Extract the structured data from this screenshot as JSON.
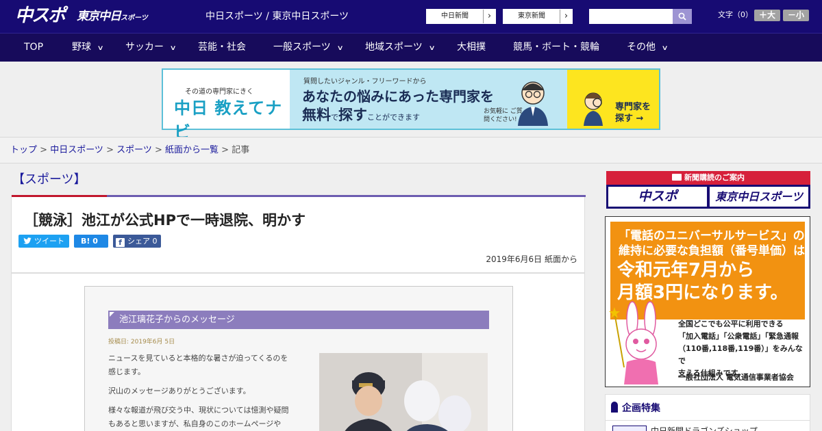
{
  "header": {
    "logo_main": "中スポ",
    "logo_sub": "東京中日",
    "logo_sub_small": "スポーツ",
    "title": "中日スポーツ / 東京中日スポーツ",
    "link_chunichi": "中日新聞",
    "link_tokyo": "東京新聞",
    "arrow": "›",
    "search_placeholder": "",
    "font_size_label": "文字（0）",
    "font_bigger": "＋大",
    "font_smaller": "－小"
  },
  "nav": {
    "items": [
      {
        "label": "TOP"
      },
      {
        "label": "野球"
      },
      {
        "label": "サッカー"
      },
      {
        "label": "芸能・社会"
      },
      {
        "label": "一般スポーツ"
      },
      {
        "label": "地域スポーツ"
      },
      {
        "label": "大相撲"
      },
      {
        "label": "競馬・ボート・競輪"
      },
      {
        "label": "その他"
      }
    ],
    "chevron": "∨"
  },
  "banner": {
    "small": "その道の専門家にきく",
    "brand": "中日 教えてナビ",
    "line1": "質問したいジャンル・フリーワードから",
    "line2": "あなたの悩みにあった専門家を",
    "line3a": "無料",
    "line3b": "で",
    "line3c": "探す",
    "line3d": "ことができます",
    "note": "お気軽に ご質問ください!",
    "cta1": "専門家を",
    "cta2": "探す →"
  },
  "breadcrumb": {
    "items": [
      "トップ",
      "中日スポーツ",
      "スポーツ",
      "紙面から一覧"
    ],
    "current": "記事",
    "sep": " > "
  },
  "section_label": "【スポーツ】",
  "article": {
    "headline": "［競泳］池江が公式HPで一時退院、明かす",
    "share_tweet": "ツイート",
    "share_hatena": "B! 0",
    "share_facebook": "シェア 0",
    "date": "2019年6月6日",
    "source": "紙面から",
    "image": {
      "title": "池江璃花子からのメッセージ",
      "posted": "投稿日: 2019年6月 5日",
      "p1a": "ニュースを見ていると本格的な暑さが迫ってくるのを",
      "p1b": "感じます。",
      "p2": "沢山のメッセージありがとうございます。",
      "p3a": "様々な報道が飛び交う中、現状については憶測や疑問",
      "p3b": "もあると思いますが、私自身のこのホームページや"
    }
  },
  "sidebar": {
    "subscribe_header": "新聞購読のご案内",
    "subscribe_btn1": "中スポ",
    "subscribe_btn2": "東京中日スポーツ",
    "ad_title1": "「電話のユニバーサルサービス」の",
    "ad_title2": "維持に必要な負担額（番号単価）は",
    "ad_big1": "令和元年7月から",
    "ad_big2": "月額3円になります。",
    "ad_text1": "全国どこでも公平に利用できる",
    "ad_text2": "「加入電話」「公衆電話」「緊急通報",
    "ad_text3": "（110番,118番,119番）」をみんなで",
    "ad_text4": "支える仕組みです。",
    "ad_org": "一般社団法人 電気通信事業者協会",
    "feature_header": "企画特集",
    "feature_item": "中日新聞ドラゴンズショップ"
  },
  "colors": {
    "header_bg": "#170b73",
    "nav_bg": "#170b5b",
    "link": "#1a1a9c",
    "accent_red": "#c1162c",
    "accent_purple": "#6c5bb0"
  }
}
